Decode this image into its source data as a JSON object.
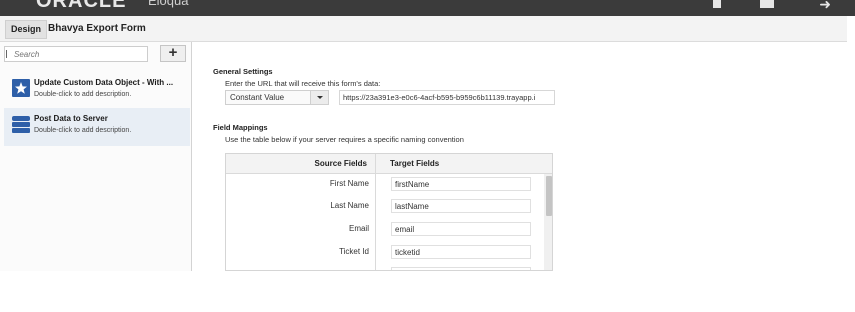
{
  "app": {
    "logo_text": "ORACLE",
    "product_text": "Eloqua"
  },
  "header": {
    "design_tab": "Design",
    "form_name": "Bhavya Export Form"
  },
  "sidebar": {
    "search": {
      "placeholder": "Search"
    },
    "add_label": "+",
    "items": [
      {
        "title": "Update Custom Data Object - With ...",
        "description": "Double-click to add description.",
        "icon": "custom-data-object-icon"
      },
      {
        "title": "Post Data to Server",
        "description": "Double-click to add description.",
        "icon": "server-icon"
      }
    ]
  },
  "general_settings": {
    "title": "General Settings",
    "url_label": "Enter the URL that will receive this form's data:",
    "url_type": "Constant Value",
    "url_value": "https://23a391e3-e0c6-4acf-b595-b959c6b11139.trayapp.i"
  },
  "field_mappings": {
    "title": "Field Mappings",
    "description": "Use the table below if your server requires a specific naming convention",
    "columns": {
      "source": "Source Fields",
      "target": "Target Fields"
    },
    "rows": [
      {
        "source": "First Name",
        "target": "firstName"
      },
      {
        "source": "Last Name",
        "target": "lastName"
      },
      {
        "source": "Email",
        "target": "email"
      },
      {
        "source": "Ticket Id",
        "target": "ticketid"
      },
      {
        "source": "",
        "target": ""
      }
    ]
  },
  "colors": {
    "topbar": "#3b3b3b",
    "selected_item": "#e8eef5",
    "icon_blue": "#2e5fa8"
  }
}
